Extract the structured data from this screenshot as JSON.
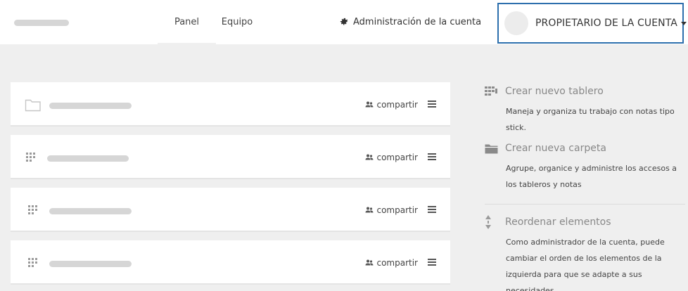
{
  "nav": {
    "tabs": [
      {
        "label": "Panel",
        "active": true
      },
      {
        "label": "Equipo",
        "active": false
      }
    ],
    "admin_label": "Administración de la cuenta",
    "account_label": "PROPIETARIO DE LA CUENTA"
  },
  "items": [
    {
      "type": "folder",
      "icon": "folder-icon",
      "share_label": "compartir"
    },
    {
      "type": "board",
      "icon": "board-grid-icon",
      "share_label": "compartir"
    },
    {
      "type": "board",
      "icon": "board-grid-icon",
      "share_label": "compartir"
    },
    {
      "type": "board",
      "icon": "board-grid-icon",
      "share_label": "compartir"
    }
  ],
  "actions": [
    {
      "title": "Crear nuevo tablero",
      "description": "Maneja y organiza tu trabajo con notas tipo stick.",
      "icon": "new-board-icon"
    },
    {
      "title": "Crear nueva carpeta",
      "description": "Agrupe, organice y administre los accesos a los tableros y notas",
      "icon": "folder-icon"
    },
    {
      "title": "Reordenar elementos",
      "description": "Como administrador de la cuenta, puede cambiar el orden de los elementos de la izquierda para que se adapte a sus necesidades.",
      "icon": "reorder-arrows-icon"
    }
  ],
  "colors": {
    "accent_border": "#2d6fad",
    "background": "#efefef"
  }
}
